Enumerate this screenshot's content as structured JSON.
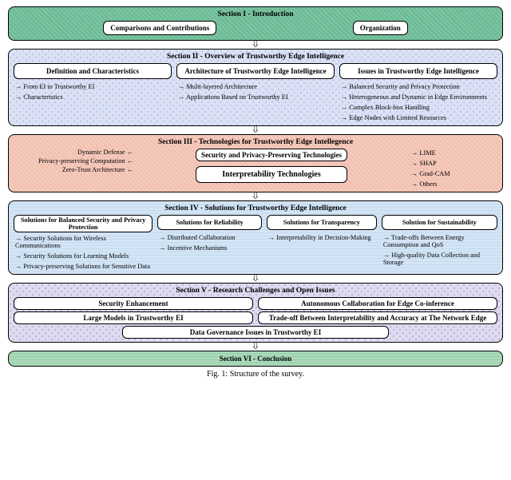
{
  "s1": {
    "title": "Section I - Introduction",
    "a": "Comparisons  and Contributions",
    "b": "Organization"
  },
  "s2": {
    "title": "Section II - Overview of Trustworthy Edge Intelligence",
    "c1": {
      "h": "Definition and Characteristics",
      "i1": "From EI to Trustworthy EI",
      "i2": "Characteristics"
    },
    "c2": {
      "h": "Architecture of Trustworthy Edge Intelligence",
      "i1": "Multi-layered Architecture",
      "i2": "Applications Based on Trustworthy EI"
    },
    "c3": {
      "h": "Issues in Trustworthy Edge Intelligence",
      "i1": "Balanced Security and Privacy Protection",
      "i2": "Heterogeneous and Dynamic in Edge Environments",
      "i3": "Complex Block-box Handling",
      "i4": "Edge Nodes with Limited Resources"
    }
  },
  "s3": {
    "title": "Section III - Technologies for Trustworthy Edge Intellegence",
    "ba": "Security and Privacy-Preserving Technologies",
    "bb": "Interpretability Technologies",
    "l1": "Dynamic Defense",
    "l2": "Privacy-preserving Computation",
    "l3": "Zero-Trust Architecture",
    "r1": "LIME",
    "r2": "SHAP",
    "r3": "Grad-CAM",
    "r4": "Others"
  },
  "s4": {
    "title": "Section IV - Solutions for Trustworthy Edge Intelligence",
    "c1": {
      "h": "Solutions for Balanced Security and Privacy Protection",
      "i1": "Security Solutions for Wireless Communications",
      "i2": "Security Solutions for Learning Models",
      "i3": "Privacy-preserving Solutions for Sensitive Data"
    },
    "c2": {
      "h": "Solutions for Reliability",
      "i1": "Distributed Collaboration",
      "i2": "Incentive Mechanisms"
    },
    "c3": {
      "h": "Solutions for Transparency",
      "i1": "Interpretability in Decision-Making"
    },
    "c4": {
      "h": "Solution for Sustainability",
      "i1": "Trade-offs Between Energy Consumption and QoS",
      "i2": "High-quality Data Collection and Storage"
    }
  },
  "s5": {
    "title": "Section V - Research Challenges and Open Issues",
    "a": "Security Enhancement",
    "b": "Autonomous Collaboration for Edge Co-inference",
    "c": "Large Models in Trustworthy EI",
    "d": "Trade-off Between Interpretability and Accuracy at The Network Edge",
    "e": "Data Governance Issues in Trustworthy EI"
  },
  "s6": {
    "title": "Section VI - Conclusion"
  },
  "caption": "Fig. 1: Structure of the survey."
}
